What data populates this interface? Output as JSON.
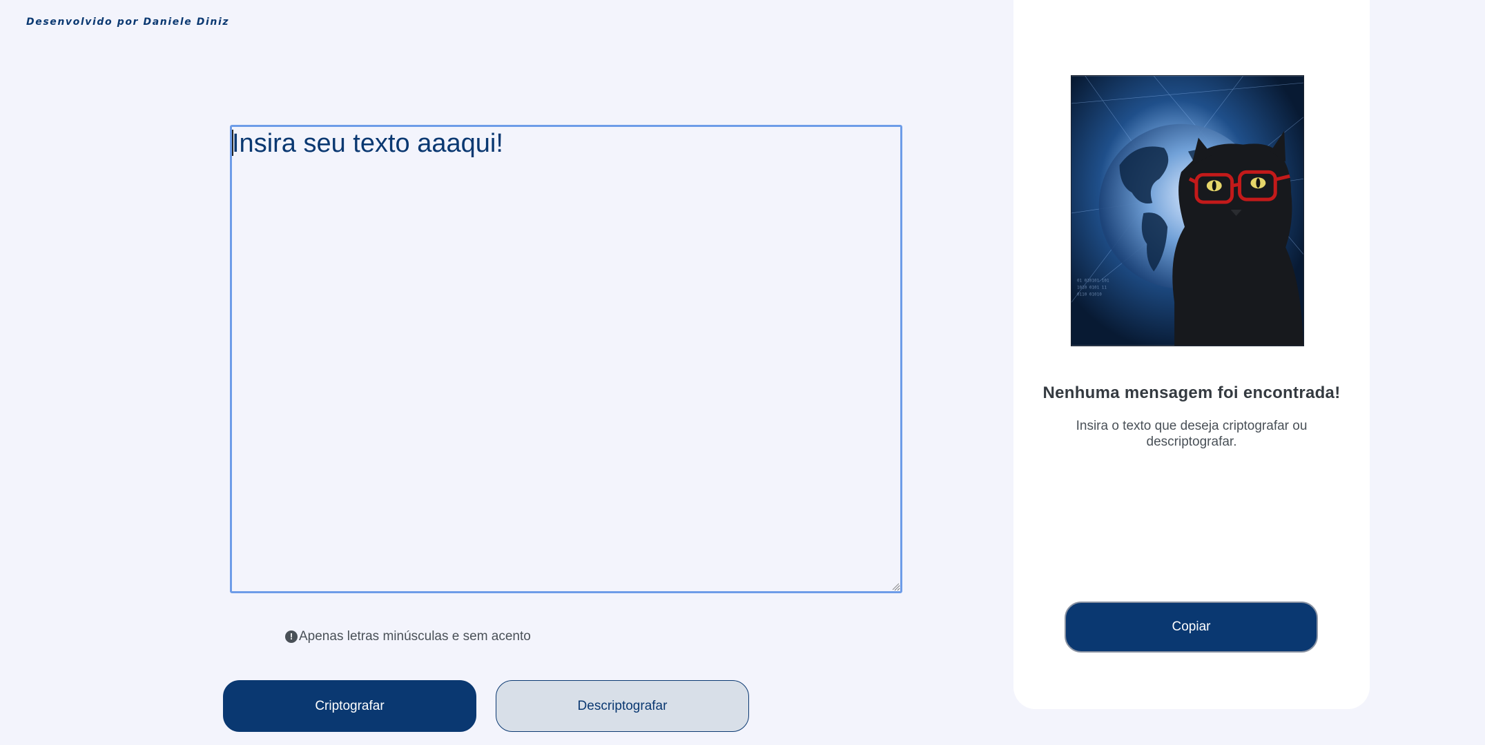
{
  "credit": "Desenvolvido por Daniele Diniz",
  "input": {
    "placeholder": "Insira seu texto aaaqui!",
    "value": ""
  },
  "hint": {
    "icon": "exclamation-circle-icon",
    "text": "Apenas letras minúsculas e sem acento"
  },
  "buttons": {
    "encrypt": "Criptografar",
    "decrypt": "Descriptografar",
    "copy": "Copiar"
  },
  "output_panel": {
    "image": "black-cat-glasses-globe-illustration",
    "title": "Nenhuma mensagem foi encontrada!",
    "description": "Insira o texto que deseja criptografar ou descriptografar."
  },
  "colors": {
    "background": "#f3f4fc",
    "primary": "#0a3871",
    "secondary_button": "#d8dfe8",
    "focus_border": "#6d9ce8",
    "panel": "#ffffff"
  }
}
